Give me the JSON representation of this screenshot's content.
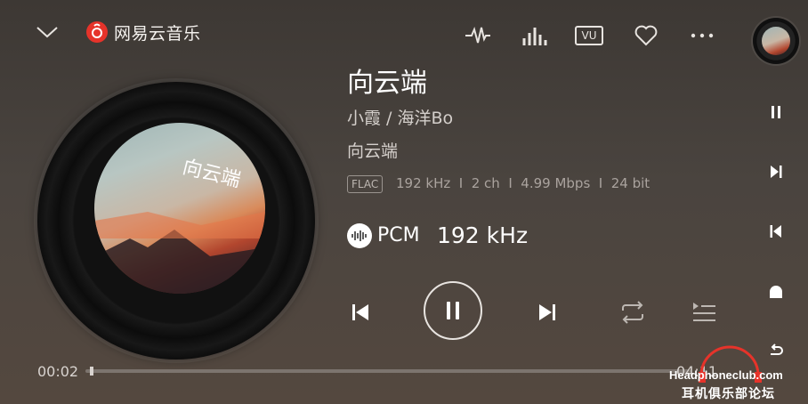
{
  "header": {
    "brand": "网易云音乐",
    "icons": [
      "chevron-down-icon",
      "netease-logo-icon",
      "waveform-icon",
      "equalizer-icon",
      "vu-meter-icon",
      "heart-icon",
      "more-icon"
    ],
    "vu_label": "VU"
  },
  "track": {
    "title": "向云端",
    "artist": "小霞 / 海洋Bo",
    "album": "向云端",
    "format": "FLAC",
    "specs": "192 kHz  I  2 ch  I  4.99 Mbps  I  24 bit",
    "output_label": "PCM",
    "output_rate": "192 kHz"
  },
  "cover": {
    "art_text": "向云端"
  },
  "controls": {
    "icons": [
      "previous-icon",
      "pause-icon",
      "next-icon",
      "repeat-icon",
      "queue-icon"
    ]
  },
  "progress": {
    "elapsed": "00:02",
    "total": "04:11",
    "fraction": 0.008
  },
  "rail": {
    "icons": [
      "pause-icon",
      "next-icon",
      "previous-icon",
      "home-icon",
      "back-icon"
    ]
  },
  "watermark": {
    "site": "Headphoneclub.com",
    "forum": "耳机俱乐部论坛"
  },
  "colors": {
    "background": "#4a443f",
    "logo_red": "#e6332a",
    "text_secondary": "#d4cfcb"
  }
}
